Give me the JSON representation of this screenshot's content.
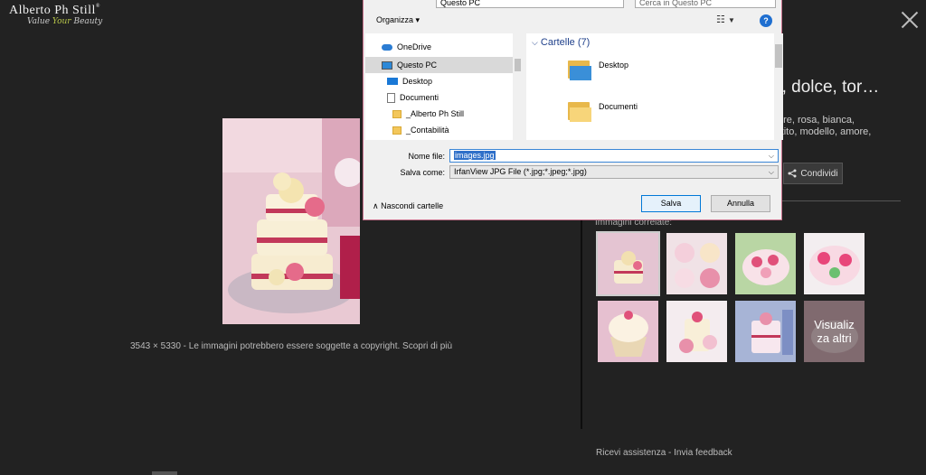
{
  "logo": {
    "name": "Alberto Ph Still",
    "sup": "®",
    "tagline_1": "Value ",
    "tagline_accent": "Your",
    "tagline_2": " Beauty"
  },
  "main": {
    "dimensions": "3543 × 5330",
    "copyright": "Le immagini potrebbero essere soggette a copyright.",
    "learn_more": "Scopri di più"
  },
  "side": {
    "title": "o, dolce, tor…",
    "tags_line1": "ore, rosa, bianca,",
    "tags_line2": "rtito, modello, amore,",
    "share_label": "Condividi",
    "related_label": "Immagini correlate:",
    "see_more_line1": "Visualiz",
    "see_more_line2": "za altri",
    "help": "Ricevi assistenza",
    "feedback": "Invia feedback",
    "footer_sep": " - "
  },
  "dialog": {
    "address": "Questo PC",
    "search_placeholder": "Cerca in Questo PC",
    "organize": "Organizza",
    "help_icon": "?",
    "nav": [
      "OneDrive",
      "Questo PC",
      "Desktop",
      "Documenti",
      "_Alberto Ph Still",
      "_Contabilità"
    ],
    "folders_header": "Cartelle (7)",
    "folders": [
      "Desktop",
      "Documenti"
    ],
    "filename_label": "Nome file:",
    "filename_value": "images.jpg",
    "filetype_label": "Salva come:",
    "filetype_value": "IrfanView JPG File (*.jpg;*.jpeg;*.jpg)",
    "hide_folders": "Nascondi cartelle",
    "save": "Salva",
    "cancel": "Annulla"
  },
  "colors": {
    "background": "#222222",
    "dialog_border": "#c8718d",
    "selection": "#2f70c9"
  }
}
